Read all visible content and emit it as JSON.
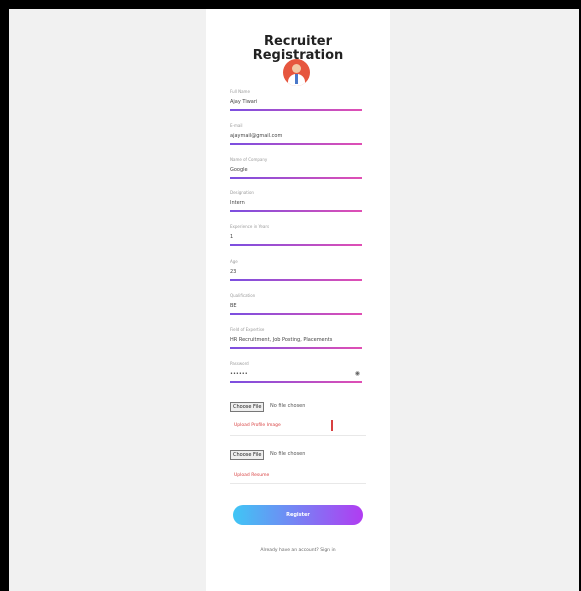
{
  "form": {
    "title_line1": "Recruiter",
    "title_line2": "Registration",
    "fields": [
      {
        "label": "Full Name",
        "value": "Ajay Tiwari"
      },
      {
        "label": "E-mail",
        "value": "ajaymail@gmail.com"
      },
      {
        "label": "Name of Company",
        "value": "Google"
      },
      {
        "label": "Designation",
        "value": "Intern"
      },
      {
        "label": "Experience in Years",
        "value": "1"
      },
      {
        "label": "Age",
        "value": "23"
      },
      {
        "label": "Qualification",
        "value": "BE"
      },
      {
        "label": "Field of Expertise",
        "value": "HR Recruitment, Job Posting, Placements"
      },
      {
        "label": "Password",
        "value": "••••••"
      }
    ],
    "password_toggle_icon": "eye-icon",
    "file_inputs": [
      {
        "button": "Choose File",
        "status": "No file chosen",
        "link": "Upload Profile Image"
      },
      {
        "button": "Choose File",
        "status": "No file chosen",
        "link": "Upload Resume"
      }
    ],
    "submit_label": "Register",
    "signin_text": "Already have an account? Sign in"
  },
  "colors": {
    "accent_start": "#3fc6f5",
    "accent_end": "#b13cf2",
    "underline_start": "#7b4fe0",
    "underline_end": "#e04fb4",
    "error_red": "#d84040",
    "avatar_red": "#e6563e"
  }
}
